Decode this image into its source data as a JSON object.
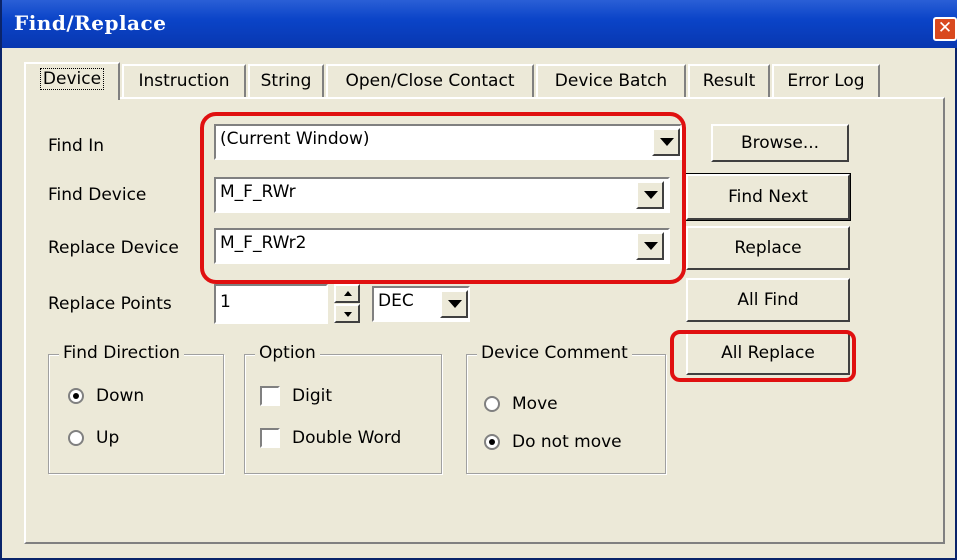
{
  "window": {
    "title": "Find/Replace",
    "close_glyph": "✕"
  },
  "tabs": [
    {
      "label": "Device",
      "active": true
    },
    {
      "label": "Instruction",
      "active": false
    },
    {
      "label": "String",
      "active": false
    },
    {
      "label": "Open/Close Contact",
      "active": false
    },
    {
      "label": "Device Batch",
      "active": false
    },
    {
      "label": "Result",
      "active": false
    },
    {
      "label": "Error Log",
      "active": false
    }
  ],
  "fields": {
    "find_in_label": "Find In",
    "find_in_value": "(Current Window)",
    "find_device_label": "Find Device",
    "find_device_value": "M_F_RWr",
    "replace_device_label": "Replace Device",
    "replace_device_value": "M_F_RWr2",
    "replace_points_label": "Replace Points",
    "replace_points_value": "1",
    "radix_value": "DEC"
  },
  "buttons": {
    "browse": "Browse...",
    "find_next": "Find Next",
    "replace": "Replace",
    "all_find": "All Find",
    "all_replace": "All Replace"
  },
  "find_direction": {
    "title": "Find Direction",
    "options": [
      {
        "label": "Down",
        "selected": true
      },
      {
        "label": "Up",
        "selected": false
      }
    ]
  },
  "option": {
    "title": "Option",
    "checks": [
      {
        "label": "Digit",
        "checked": false
      },
      {
        "label": "Double Word",
        "checked": false
      }
    ]
  },
  "device_comment": {
    "title": "Device Comment",
    "options": [
      {
        "label": "Move",
        "selected": false
      },
      {
        "label": "Do not move",
        "selected": true
      }
    ]
  },
  "colors": {
    "titlebar": "#0b44c8",
    "dialog_bg": "#ece9d8",
    "highlight": "#e01010"
  }
}
